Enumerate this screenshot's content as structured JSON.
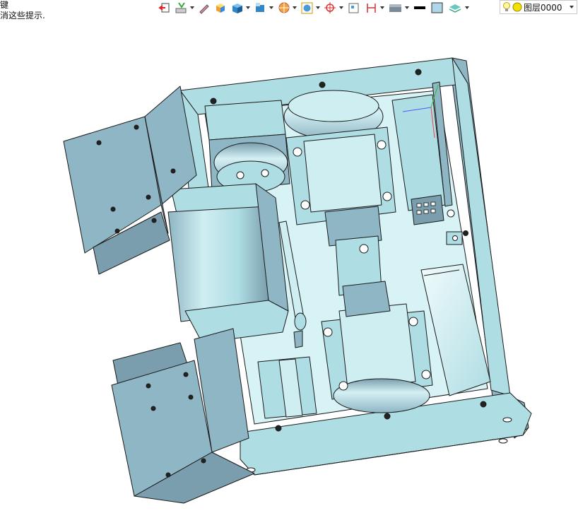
{
  "hint": {
    "line1": "键",
    "line2": "消这些提示."
  },
  "toolbar": {
    "icons": [
      "exit-icon",
      "grid-snap-icon",
      "pencil-icon",
      "shaded-cube-icon",
      "cube-view-icon",
      "section-view-icon",
      "render-mode-icon",
      "display-filter-icon",
      "snap-point-icon",
      "frame-icon",
      "dimension-icon",
      "render-style-icon",
      "line-color-swatch",
      "face-color-swatch",
      "layer-stack-icon"
    ]
  },
  "layer_selector": {
    "label": "图层0000",
    "icons": [
      "lightbulb-icon",
      "layer-color-icon"
    ]
  },
  "colors": {
    "model_face": "#aedde3",
    "model_shade": "#8fb6c4",
    "model_dark": "#7a9eae",
    "edge": "#1a1a1a"
  }
}
